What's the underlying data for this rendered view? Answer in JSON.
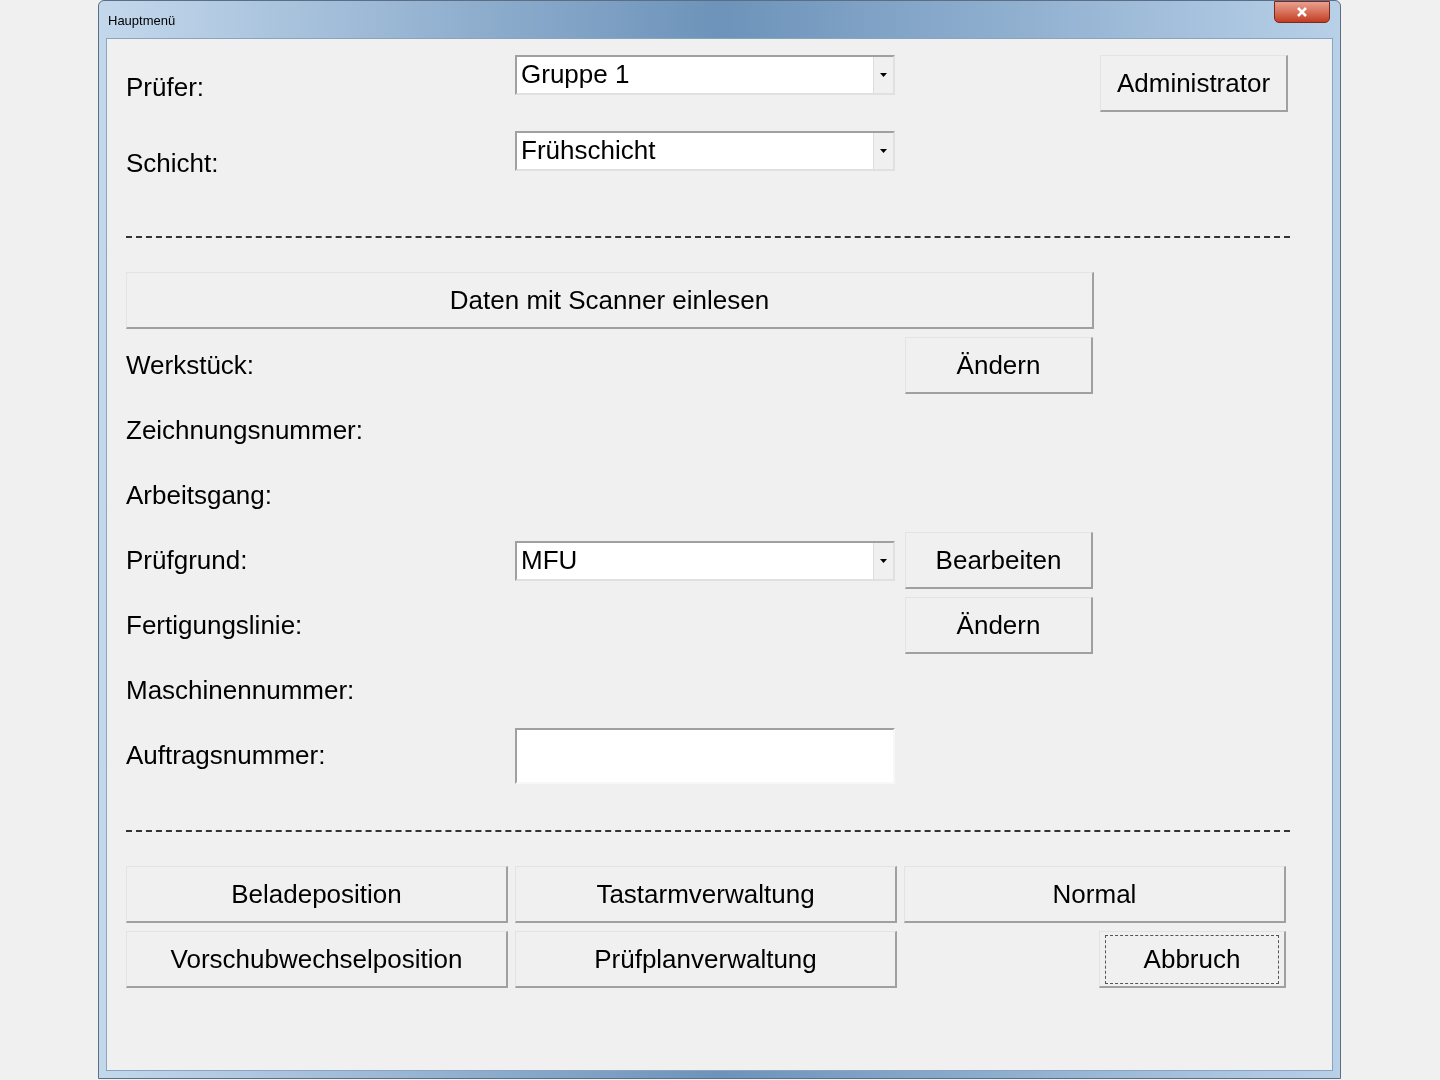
{
  "window": {
    "title": "Hauptmenü"
  },
  "header": [
    {
      "label": "Prüfer:",
      "value": "Gruppe 1"
    },
    {
      "label": "Schicht:",
      "value": "Frühschicht"
    }
  ],
  "admin_button": "Administrator",
  "scan_button": "Daten mit Scanner einlesen",
  "fields": [
    {
      "kind": "text",
      "label": "Werkstück:",
      "button": "Ändern"
    },
    {
      "kind": "text",
      "label": "Zeichnungsnummer:"
    },
    {
      "kind": "text",
      "label": "Arbeitsgang:"
    },
    {
      "kind": "combo",
      "label": "Prüfgrund:",
      "value": "MFU",
      "button": "Bearbeiten"
    },
    {
      "kind": "text",
      "label": "Fertigungslinie:",
      "button": "Ändern"
    },
    {
      "kind": "text",
      "label": "Maschinennummer:"
    },
    {
      "kind": "input",
      "label": "Auftragsnummer:"
    }
  ],
  "bottom_buttons": [
    {
      "label": "Beladeposition",
      "focused": false
    },
    {
      "label": "Tastarmverwaltung",
      "focused": false
    },
    {
      "label": "Normal",
      "focused": false
    },
    {
      "label": "Vorschubwechselposition",
      "focused": false
    },
    {
      "label": "Prüfplanverwaltung",
      "focused": false
    },
    {
      "label": "Abbruch",
      "focused": true
    }
  ]
}
